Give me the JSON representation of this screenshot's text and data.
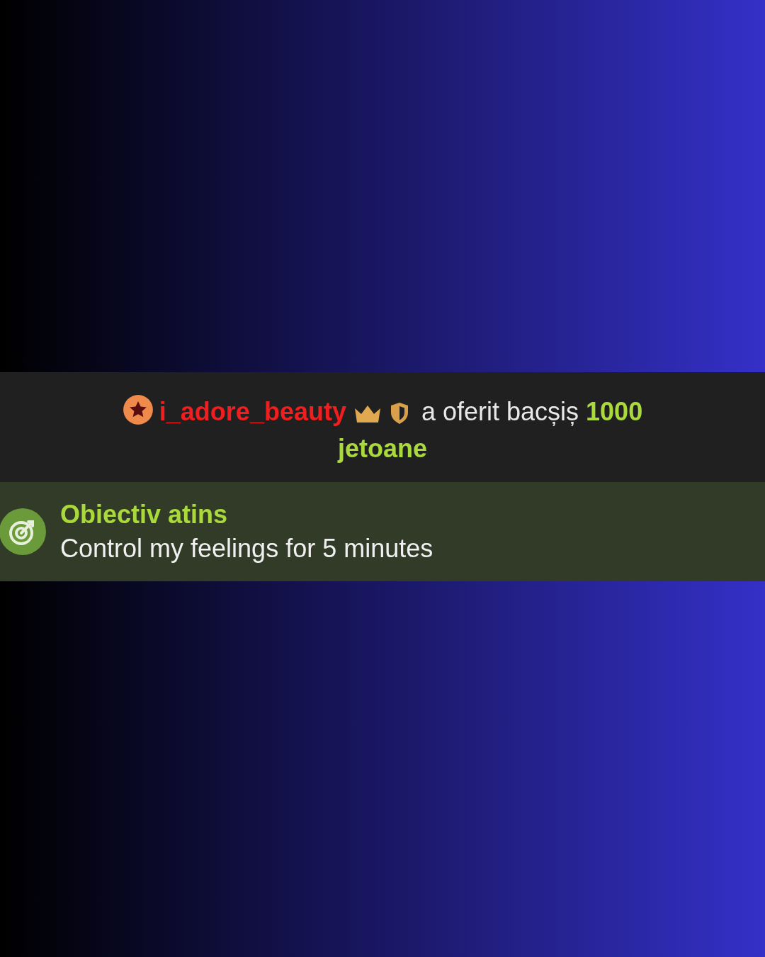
{
  "tip": {
    "username": "i_adore_beauty",
    "action": "a oferit bacșiș",
    "amount": "1000",
    "unit": "jetoane"
  },
  "goal": {
    "title": "Obiectiv atins",
    "description": "Control my feelings for 5 minutes"
  }
}
